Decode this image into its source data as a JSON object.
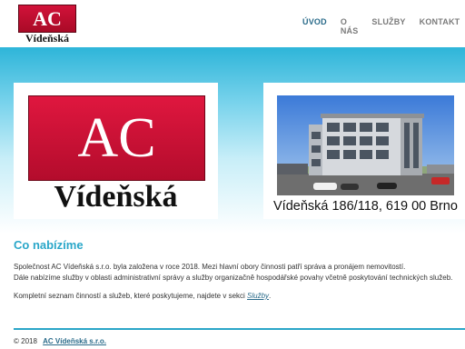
{
  "header": {
    "logo_small": {
      "initials": "AC",
      "name": "Vídeňská"
    },
    "nav": [
      "ÚVOD",
      "O NÁS",
      "SLUŽBY",
      "KONTAKT"
    ]
  },
  "hero": {
    "logo_big": {
      "initials": "AC",
      "name": "Vídeňská"
    },
    "address": "Vídeňská 186/118, 619 00 Brno"
  },
  "main": {
    "title": "Co nabízíme",
    "para1_line1": "Společnost AC Vídeňská s.r.o. byla založena v roce 2018. Mezi hlavní obory činnosti patří správa a pronájem nemovitostí.",
    "para1_line2": "Dále nabízíme služby v oblasti administrativní správy a služby organizačně hospodářské povahy včetně poskytování technických služeb.",
    "para2_text": "Kompletní seznam činností a služeb, které poskytujeme, najdete v sekci ",
    "para2_link": "Služby",
    "para2_end": "."
  },
  "footer": {
    "copyright": "© 2018",
    "company": "AC Vídeňská s.r.o."
  },
  "colors": {
    "accent": "#2aa7c9",
    "logo_red": "#c8102e",
    "nav_active": "#2a6b8a"
  }
}
